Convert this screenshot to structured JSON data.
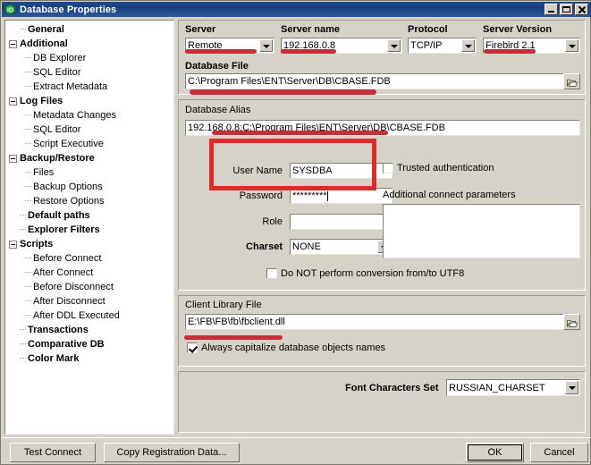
{
  "window": {
    "title": "Database Properties",
    "icon": "database-hex-icon",
    "controls": {
      "minimize": "minimize-icon",
      "maximize": "maximize-icon",
      "close": "close-icon"
    }
  },
  "sidebar": {
    "items": [
      {
        "label": "General",
        "level": 0,
        "bold": true,
        "twisty": false,
        "dash": true
      },
      {
        "label": "Additional",
        "level": 0,
        "bold": true,
        "twisty": true,
        "dash": false
      },
      {
        "label": "DB Explorer",
        "level": 1,
        "bold": false,
        "twisty": false,
        "dash": true
      },
      {
        "label": "SQL Editor",
        "level": 1,
        "bold": false,
        "twisty": false,
        "dash": true
      },
      {
        "label": "Extract Metadata",
        "level": 1,
        "bold": false,
        "twisty": false,
        "dash": true
      },
      {
        "label": "Log Files",
        "level": 0,
        "bold": true,
        "twisty": true,
        "dash": false
      },
      {
        "label": "Metadata Changes",
        "level": 1,
        "bold": false,
        "twisty": false,
        "dash": true
      },
      {
        "label": "SQL Editor",
        "level": 1,
        "bold": false,
        "twisty": false,
        "dash": true
      },
      {
        "label": "Script Executive",
        "level": 1,
        "bold": false,
        "twisty": false,
        "dash": true
      },
      {
        "label": "Backup/Restore",
        "level": 0,
        "bold": true,
        "twisty": true,
        "dash": false
      },
      {
        "label": "Files",
        "level": 1,
        "bold": false,
        "twisty": false,
        "dash": true
      },
      {
        "label": "Backup Options",
        "level": 1,
        "bold": false,
        "twisty": false,
        "dash": true
      },
      {
        "label": "Restore Options",
        "level": 1,
        "bold": false,
        "twisty": false,
        "dash": true
      },
      {
        "label": "Default paths",
        "level": 0,
        "bold": true,
        "twisty": false,
        "dash": true
      },
      {
        "label": "Explorer Filters",
        "level": 0,
        "bold": true,
        "twisty": false,
        "dash": true
      },
      {
        "label": "Scripts",
        "level": 0,
        "bold": true,
        "twisty": true,
        "dash": false
      },
      {
        "label": "Before Connect",
        "level": 1,
        "bold": false,
        "twisty": false,
        "dash": true
      },
      {
        "label": "After Connect",
        "level": 1,
        "bold": false,
        "twisty": false,
        "dash": true
      },
      {
        "label": "Before Disconnect",
        "level": 1,
        "bold": false,
        "twisty": false,
        "dash": true
      },
      {
        "label": "After Disconnect",
        "level": 1,
        "bold": false,
        "twisty": false,
        "dash": true
      },
      {
        "label": "After DDL Executed",
        "level": 1,
        "bold": false,
        "twisty": false,
        "dash": true
      },
      {
        "label": "Transactions",
        "level": 0,
        "bold": true,
        "twisty": false,
        "dash": true
      },
      {
        "label": "Comparative DB",
        "level": 0,
        "bold": true,
        "twisty": false,
        "dash": true
      },
      {
        "label": "Color Mark",
        "level": 0,
        "bold": true,
        "twisty": false,
        "dash": true
      }
    ]
  },
  "form": {
    "server": {
      "label": "Server",
      "value": "Remote"
    },
    "server_name": {
      "label": "Server name",
      "value": "192.168.0.8"
    },
    "protocol": {
      "label": "Protocol",
      "value": "TCP/IP"
    },
    "server_version": {
      "label": "Server Version",
      "value": "Firebird 2.1"
    },
    "database_file": {
      "label": "Database File",
      "value": "C:\\Program Files\\ENT\\Server\\DB\\CBASE.FDB",
      "browse": "browse-folder-icon"
    },
    "database_alias": {
      "label": "Database Alias",
      "value": "192.168.0.8:C:\\Program Files\\ENT\\Server\\DB\\CBASE.FDB"
    },
    "user_name": {
      "label": "User Name",
      "value": "SYSDBA"
    },
    "password": {
      "label": "Password",
      "value": "*********"
    },
    "role": {
      "label": "Role",
      "value": ""
    },
    "charset": {
      "label": "Charset",
      "value": "NONE"
    },
    "trusted_auth": {
      "label": "Trusted authentication",
      "checked": false
    },
    "additional_params": {
      "label": "Additional connect parameters",
      "value": ""
    },
    "no_utf8_conversion": {
      "label": "Do NOT perform conversion from/to UTF8",
      "checked": false
    },
    "client_library": {
      "label": "Client Library File",
      "value": "E:\\FB\\FB\\fb\\fbclient.dll",
      "browse": "browse-folder-icon"
    },
    "capitalize": {
      "label": "Always capitalize database objects names",
      "checked": true
    },
    "font_charset": {
      "label": "Font Characters Set",
      "value": "RUSSIAN_CHARSET"
    }
  },
  "buttons": {
    "test_connect": "Test Connect",
    "copy_registration": "Copy Registration Data...",
    "ok": "OK",
    "cancel": "Cancel"
  },
  "annotations": {
    "color_underline": "#c4303a",
    "color_rect": "#e02a2a"
  }
}
